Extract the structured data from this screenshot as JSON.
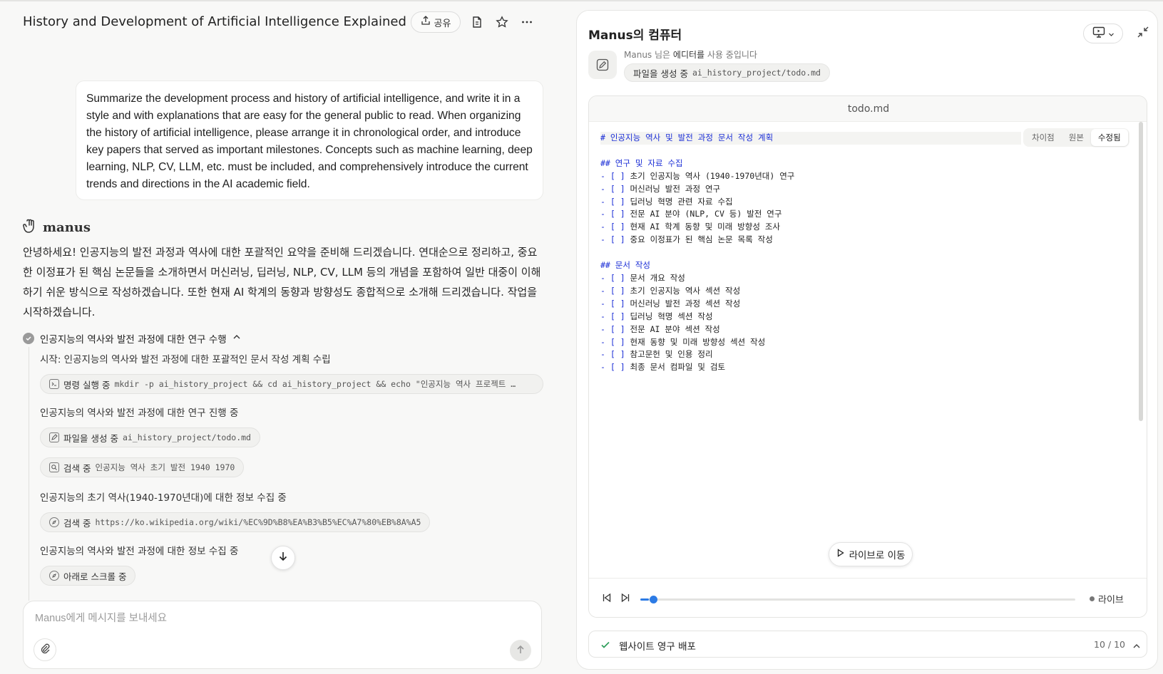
{
  "header": {
    "title": "History and Development of Artificial Intelligence Explained",
    "share_label": "공유",
    "icons": [
      "share-icon",
      "document-icon",
      "star-icon",
      "more-icon"
    ]
  },
  "user_message": "Summarize the development process and history of artificial intelligence, and write it in a style and with explanations that are easy for the general public to read. When organizing the history of artificial intelligence, please arrange it in chronological order, and introduce key papers that served as important milestones. Concepts such as machine learning, deep learning, NLP, CV, LLM, etc. must be included, and comprehensively introduce the current trends and directions in the AI academic field.",
  "assistant": {
    "brand": "manus",
    "reply": "안녕하세요! 인공지능의 발전 과정과 역사에 대한 포괄적인 요약을 준비해 드리겠습니다. 연대순으로 정리하고, 중요한 이정표가 된 핵심 논문들을 소개하면서 머신러닝, 딥러닝, NLP, CV, LLM 등의 개념을 포함하여 일반 대중이 이해하기 쉬운 방식으로 작성하겠습니다. 또한 현재 AI 학계의 동향과 방향성도 종합적으로 소개해 드리겠습니다. 작업을 시작하겠습니다."
  },
  "task": {
    "title": "인공지능의 역사와 발전 과정에 대한 연구 수행",
    "steps": [
      "시작: 인공지능의 역사와 발전 과정에 대한 포괄적인 문서 작성 계획 수립",
      "인공지능의 역사와 발전 과정에 대한 연구 진행 중",
      "인공지능의 초기 역사(1940-1970년대)에 대한 정보 수집 중",
      "인공지능의 역사와 발전 과정에 대한 정보 수집 중"
    ],
    "actions": [
      {
        "label": "명령 실행 중",
        "detail": "mkdir -p ai_history_project && cd ai_history_project && echo \"인공지능 역사 프로젝트 …",
        "icon": "terminal-icon"
      },
      {
        "label": "파일을 생성 중",
        "detail": "ai_history_project/todo.md",
        "icon": "edit-icon"
      },
      {
        "label": "검색 중",
        "detail": "인공지능 역사 초기 발전 1940 1970",
        "icon": "search-icon"
      },
      {
        "label": "검색 중",
        "detail": "https://ko.wikipedia.org/wiki/%EC%9D%B8%EA%B3%B5%EC%A7%80%EB%8A%A5",
        "icon": "compass-icon"
      },
      {
        "label": "아래로 스크롤 중",
        "detail": "",
        "icon": "compass-icon"
      }
    ]
  },
  "composer": {
    "placeholder": "Manus에게 메시지를 보내세요"
  },
  "computer": {
    "title": "Manus의 컴퓨터",
    "status_prefix": "Manus 님은",
    "status_app": "에디터를",
    "status_suffix": "사용 중입니다",
    "current_action": "파일을 생성 중",
    "current_file": "ai_history_project/todo.md",
    "viewer_title": "todo.md",
    "view_tabs": [
      "차이점",
      "원본",
      "수정됨"
    ],
    "active_tab": "수정됨",
    "file_lines": [
      {
        "kind": "h1",
        "text": "# 인공지능 역사 및 발전 과정 문서 작성 계획"
      },
      {
        "kind": "blank",
        "text": ""
      },
      {
        "kind": "h2",
        "text": "## 연구 및 자료 수집"
      },
      {
        "kind": "todo",
        "text": "초기 인공지능 역사 (1940-1970년대) 연구"
      },
      {
        "kind": "todo",
        "text": "머신러닝 발전 과정 연구"
      },
      {
        "kind": "todo",
        "text": "딥러닝 혁명 관련 자료 수집"
      },
      {
        "kind": "todo",
        "text": "전문 AI 분야 (NLP, CV 등) 발전 연구"
      },
      {
        "kind": "todo",
        "text": "현재 AI 학계 동향 및 미래 방향성 조사"
      },
      {
        "kind": "todo",
        "text": "중요 이정표가 된 핵심 논문 목록 작성"
      },
      {
        "kind": "blank",
        "text": ""
      },
      {
        "kind": "h2",
        "text": "## 문서 작성"
      },
      {
        "kind": "todo",
        "text": "문서 개요 작성"
      },
      {
        "kind": "todo",
        "text": "초기 인공지능 역사 섹션 작성"
      },
      {
        "kind": "todo",
        "text": "머신러닝 발전 과정 섹션 작성"
      },
      {
        "kind": "todo",
        "text": "딥러닝 혁명 섹션 작성"
      },
      {
        "kind": "todo",
        "text": "전문 AI 분야 섹션 작성"
      },
      {
        "kind": "todo",
        "text": "현재 동향 및 미래 방향성 섹션 작성"
      },
      {
        "kind": "todo",
        "text": "참고문헌 및 인용 정리"
      },
      {
        "kind": "todo",
        "text": "최종 문서 컴파일 및 검토"
      }
    ],
    "todo_marker": "- [ ]",
    "jump_live_label": "라이브로 이동",
    "live_label": "라이브",
    "playback_progress": 0.02
  },
  "deploy": {
    "label": "웹사이트 영구 배포",
    "count": "10 / 10"
  },
  "colors": {
    "markdown_heading": "#1c2fd6",
    "progress": "#2c7be5",
    "success": "#2e9e5b"
  }
}
